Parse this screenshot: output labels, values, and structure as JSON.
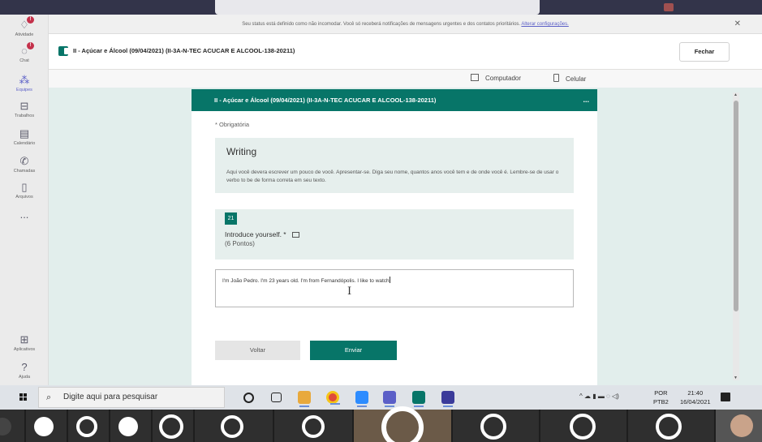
{
  "notification": {
    "text": "Seu status está definido como não incomodar. Você só receberá notificações de mensagens urgentes e dos contatos prioritários.",
    "link": "Alterar configurações.",
    "close_icon": "close-icon"
  },
  "rail": {
    "items": [
      {
        "label": "Atividade",
        "icon": "bell-icon",
        "badge": "!"
      },
      {
        "label": "Chat",
        "icon": "chat-icon",
        "badge": "!"
      },
      {
        "label": "Equipes",
        "icon": "teams-icon"
      },
      {
        "label": "Trabalhos",
        "icon": "briefcase-icon"
      },
      {
        "label": "Calendário",
        "icon": "calendar-icon"
      },
      {
        "label": "Chamadas",
        "icon": "phone-icon"
      },
      {
        "label": "Arquivos",
        "icon": "file-icon"
      },
      {
        "label": "...",
        "icon": "more-icon"
      },
      {
        "label": "Aplicativos",
        "icon": "apps-icon"
      },
      {
        "label": "Ajuda",
        "icon": "help-icon"
      }
    ]
  },
  "appbar": {
    "title": "II - Açúcar e Álcool (09/04/2021) (II-3A-N-TEC ACUCAR E ALCOOL-138-20211)",
    "close_label": "Fechar"
  },
  "viewbar": {
    "desktop_label": "Computador",
    "mobile_label": "Celular"
  },
  "form": {
    "header_title": "II - Açúcar e Álcool (09/04/2021) (II-3A-N-TEC ACUCAR E ALCOOL-138-20211)",
    "more": "...",
    "required_note": "* Obrigatória",
    "section_title": "Writing",
    "section_description": "Aqui você devera escrever um pouco de você. Apresentar-se. Diga seu nome, quantos anos você tem e de onde você é. Lembre-se de usar o verbo to be de forma correta em seu texto.",
    "question_number": "21",
    "question_text": "Introduce yourself. *",
    "question_points": "(6 Pontos)",
    "answer_value": "I'm João Pedro. I'm 23 years old. I'm from Fernandópolis. I like to watch",
    "back_label": "Voltar",
    "send_label": "Enviar"
  },
  "taskbar": {
    "search_placeholder": "Digite aqui para pesquisar",
    "lang_top": "POR",
    "lang_bottom": "PTB2",
    "time": "21:40",
    "date": "16/04/2021",
    "tray_icons": "^ ☁ ▮ ▬ ◌ ◁)"
  },
  "colors": {
    "forms_accent": "#077568",
    "teams_purple": "#5b5fc7",
    "rail_bg": "#ebebeb"
  }
}
